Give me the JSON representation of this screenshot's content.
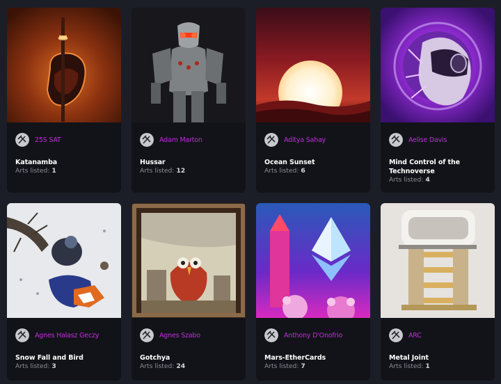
{
  "listed_label": "Arts listed:",
  "cards": [
    {
      "author": "25S SAT",
      "title": "Katanamba",
      "arts_listed": "1",
      "artwork": "katana-artwork"
    },
    {
      "author": "Adam Marton",
      "title": "Hussar",
      "arts_listed": "12",
      "artwork": "armored-robot-artwork"
    },
    {
      "author": "Aditya Sahay",
      "title": "Ocean Sunset",
      "arts_listed": "6",
      "artwork": "ocean-sunset-artwork"
    },
    {
      "author": "Aelise Davis",
      "title": "Mind Control of the Technoverse",
      "arts_listed": "4",
      "artwork": "cyber-helmet-artwork"
    },
    {
      "author": "Agnes Halasz Geczy",
      "title": "Snow Fall and Bird",
      "arts_listed": "3",
      "artwork": "snow-bird-artwork"
    },
    {
      "author": "Agnes Szabo",
      "title": "Gotchya",
      "arts_listed": "24",
      "artwork": "framed-bird-painting"
    },
    {
      "author": "Anthony D'Onofrio",
      "title": "Mars-EtherCards",
      "arts_listed": "7",
      "artwork": "ethereum-rocket-artwork"
    },
    {
      "author": "ARC",
      "title": "Metal Joint",
      "arts_listed": "1",
      "artwork": "metal-joint-artwork"
    }
  ]
}
